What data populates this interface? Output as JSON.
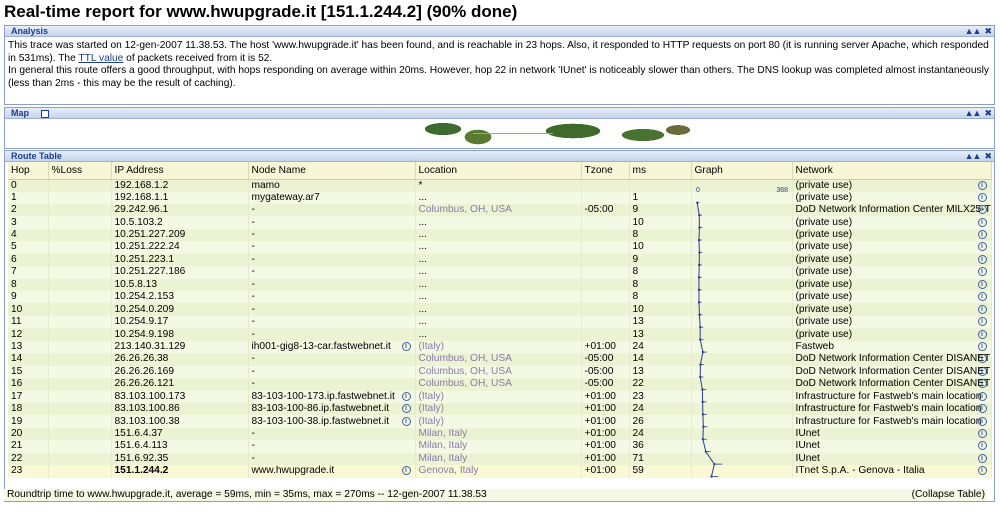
{
  "page_title": "Real-time report for www.hwupgrade.it [151.1.244.2] (90% done)",
  "analysis": {
    "header": "Analysis",
    "text_1": "This trace was started on 12-gen-2007 11.38.53. The host 'www.hwupgrade.it' has been found, and is reachable in 23 hops. Also, it responded to HTTP requests on port 80 (it is running server Apache, which responded in 531ms). The ",
    "ttl_link": "TTL value",
    "text_2": " of packets received from it is 52.",
    "text_3": "In general this route offers a good throughput, with hops responding on average within 20ms. However, hop 22 in network 'IUnet' is noticeably slower than others. The DNS lookup was completed almost instantaneously (less than 2ms - this may be the result of caching)."
  },
  "map": {
    "header": "Map"
  },
  "route_table": {
    "header": "Route Table",
    "columns": [
      "Hop",
      "%Loss",
      "IP Address",
      "Node Name",
      "Location",
      "Tzone",
      "ms",
      "Graph",
      "Network"
    ],
    "graph_min": "0",
    "graph_max": "368",
    "rows": [
      {
        "hop": "0",
        "loss": "",
        "ip": "192.168.1.2",
        "node": "mamo",
        "loc": "*",
        "tz": "",
        "ms": "",
        "net": "(private use)"
      },
      {
        "hop": "1",
        "loss": "",
        "ip": "192.168.1.1",
        "node": "mygateway.ar7",
        "loc": "...",
        "tz": "",
        "ms": "1",
        "net": "(private use)"
      },
      {
        "hop": "2",
        "loss": "",
        "ip": "29.242.96.1",
        "node": "-",
        "loc": "Columbus, OH, USA",
        "tz": "-05:00",
        "ms": "9",
        "net": "DoD Network Information Center MILX25-T"
      },
      {
        "hop": "3",
        "loss": "",
        "ip": "10.5.103.2",
        "node": "-",
        "loc": "...",
        "tz": "",
        "ms": "10",
        "net": "(private use)"
      },
      {
        "hop": "4",
        "loss": "",
        "ip": "10.251.227.209",
        "node": "-",
        "loc": "...",
        "tz": "",
        "ms": "8",
        "net": "(private use)"
      },
      {
        "hop": "5",
        "loss": "",
        "ip": "10.251.222.24",
        "node": "-",
        "loc": "...",
        "tz": "",
        "ms": "10",
        "net": "(private use)"
      },
      {
        "hop": "6",
        "loss": "",
        "ip": "10.251.223.1",
        "node": "-",
        "loc": "...",
        "tz": "",
        "ms": "9",
        "net": "(private use)"
      },
      {
        "hop": "7",
        "loss": "",
        "ip": "10.251.227.186",
        "node": "-",
        "loc": "...",
        "tz": "",
        "ms": "8",
        "net": "(private use)"
      },
      {
        "hop": "8",
        "loss": "",
        "ip": "10.5.8.13",
        "node": "-",
        "loc": "...",
        "tz": "",
        "ms": "8",
        "net": "(private use)"
      },
      {
        "hop": "9",
        "loss": "",
        "ip": "10.254.2.153",
        "node": "-",
        "loc": "...",
        "tz": "",
        "ms": "8",
        "net": "(private use)"
      },
      {
        "hop": "10",
        "loss": "",
        "ip": "10.254.0.209",
        "node": "-",
        "loc": "...",
        "tz": "",
        "ms": "10",
        "net": "(private use)"
      },
      {
        "hop": "11",
        "loss": "",
        "ip": "10.254.9.17",
        "node": "-",
        "loc": "...",
        "tz": "",
        "ms": "13",
        "net": "(private use)"
      },
      {
        "hop": "12",
        "loss": "",
        "ip": "10.254.9.198",
        "node": "-",
        "loc": "...",
        "tz": "",
        "ms": "13",
        "net": "(private use)"
      },
      {
        "hop": "13",
        "loss": "",
        "ip": "213.140.31.129",
        "node": "ih001-gig8-13-car.fastwebnet.it",
        "loc": "(Italy)",
        "tz": "+01:00",
        "ms": "24",
        "net": "Fastweb"
      },
      {
        "hop": "14",
        "loss": "",
        "ip": "26.26.26.38",
        "node": "-",
        "loc": "Columbus, OH, USA",
        "tz": "-05:00",
        "ms": "14",
        "net": "DoD Network Information Center DISANET"
      },
      {
        "hop": "15",
        "loss": "",
        "ip": "26.26.26.169",
        "node": "-",
        "loc": "Columbus, OH, USA",
        "tz": "-05:00",
        "ms": "13",
        "net": "DoD Network Information Center DISANET"
      },
      {
        "hop": "16",
        "loss": "",
        "ip": "26.26.26.121",
        "node": "-",
        "loc": "Columbus, OH, USA",
        "tz": "-05:00",
        "ms": "22",
        "net": "DoD Network Information Center DISANET"
      },
      {
        "hop": "17",
        "loss": "",
        "ip": "83.103.100.173",
        "node": "83-103-100-173.ip.fastwebnet.it",
        "loc": "(Italy)",
        "tz": "+01:00",
        "ms": "23",
        "net": "Infrastructure for Fastweb's main location"
      },
      {
        "hop": "18",
        "loss": "",
        "ip": "83.103.100.86",
        "node": "83-103-100-86.ip.fastwebnet.it",
        "loc": "(Italy)",
        "tz": "+01:00",
        "ms": "24",
        "net": "Infrastructure for Fastweb's main location"
      },
      {
        "hop": "19",
        "loss": "",
        "ip": "83.103.100.38",
        "node": "83-103-100-38.ip.fastwebnet.it",
        "loc": "(Italy)",
        "tz": "+01:00",
        "ms": "26",
        "net": "Infrastructure for Fastweb's main location"
      },
      {
        "hop": "20",
        "loss": "",
        "ip": "151.6.4.37",
        "node": "-",
        "loc": "Milan, Italy",
        "tz": "+01:00",
        "ms": "24",
        "net": "IUnet"
      },
      {
        "hop": "21",
        "loss": "",
        "ip": "151.6.4.113",
        "node": "-",
        "loc": "Milan, Italy",
        "tz": "+01:00",
        "ms": "36",
        "net": "IUnet"
      },
      {
        "hop": "22",
        "loss": "",
        "ip": "151.6.92.35",
        "node": "-",
        "loc": "Milan, Italy",
        "tz": "+01:00",
        "ms": "71",
        "net": "IUnet"
      },
      {
        "hop": "23",
        "loss": "",
        "ip": "151.1.244.2",
        "node": "www.hwupgrade.it",
        "loc": "Genova, Italy",
        "tz": "+01:00",
        "ms": "59",
        "net": "ITnet S.p.A. - Genova - Italia"
      }
    ],
    "footer": "Roundtrip time to www.hwupgrade.it, average = 59ms, min = 35ms, max = 270ms -- 12-gen-2007 11.38.53",
    "collapse_label": "(Collapse Table)"
  },
  "colors": {
    "header_text": "#1b3f8a",
    "graph_line": "#2a3f8f",
    "location_dim": "#8a7ba8"
  }
}
